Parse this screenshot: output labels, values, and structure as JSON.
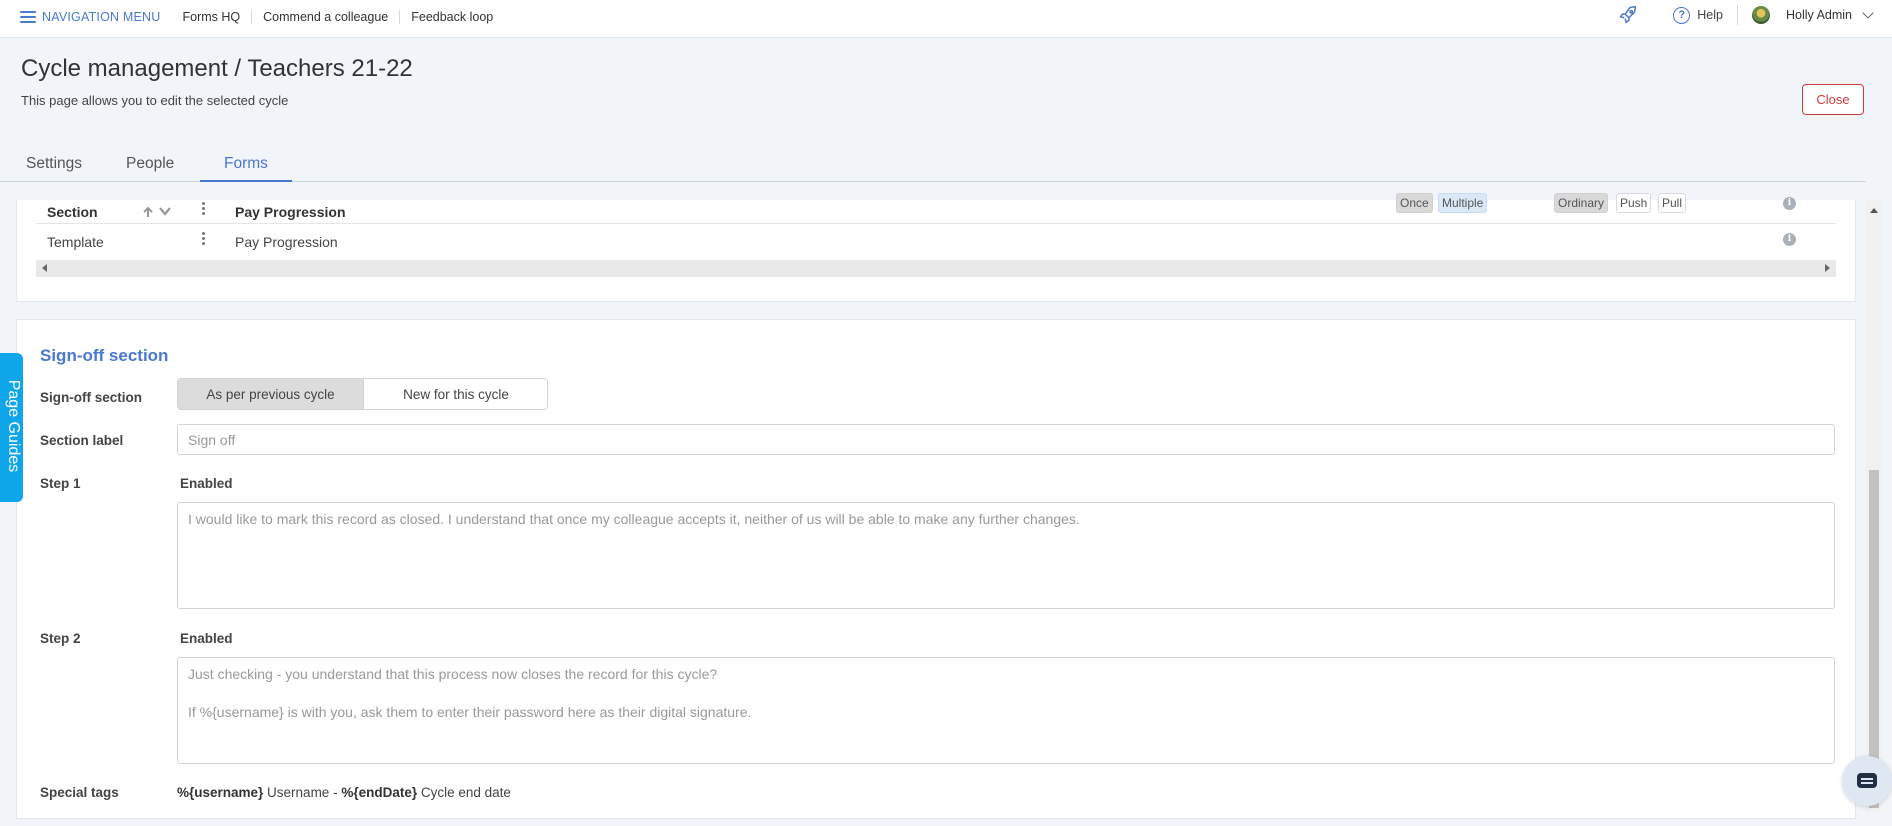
{
  "topnav": {
    "menu_label": "NAVIGATION MENU",
    "links": [
      "Forms HQ",
      "Commend a colleague",
      "Feedback loop"
    ],
    "help_label": "Help",
    "user_name": "Holly Admin"
  },
  "header": {
    "title": "Cycle management / Teachers 21-22",
    "subtitle": "This page allows you to edit the selected cycle",
    "close_label": "Close"
  },
  "tabs": [
    {
      "label": "Settings",
      "active": false
    },
    {
      "label": "People",
      "active": false
    },
    {
      "label": "Forms",
      "active": true
    }
  ],
  "table": {
    "header_row": {
      "col1": "Section",
      "col3": "Pay Progression",
      "pill_once": "Once",
      "pill_multiple": "Multiple",
      "pill_ordinary": "Ordinary",
      "pill_push": "Push",
      "pill_pull": "Pull"
    },
    "row": {
      "col1": "Template",
      "col3": "Pay Progression"
    }
  },
  "signoff": {
    "title": "Sign-off section",
    "section_label": "Sign-off section",
    "seg_option_a": "As per previous cycle",
    "seg_option_b": "New for this cycle",
    "label_field_label": "Section label",
    "label_field_placeholder": "Sign off",
    "step1_label": "Step 1",
    "step1_status": "Enabled",
    "step1_text": "I would like to mark this record as closed. I understand that once my colleague accepts it, neither of us will be able to make any further changes.",
    "step2_label": "Step 2",
    "step2_status": "Enabled",
    "step2_text_line1": "Just checking - you understand that this process now closes the record for this cycle?",
    "step2_text_line2": "If %{username} is with you, ask them to enter their password here as their digital signature.",
    "special_tags_label": "Special tags",
    "tag1": "%{username}",
    "tag1_desc": " Username - ",
    "tag2": "%{endDate}",
    "tag2_desc": " Cycle end date"
  },
  "page_guides_label": "Page Guides",
  "colors": {
    "accent": "#4a78d0",
    "danger": "#d23a3a",
    "guides": "#0ea5e9"
  }
}
